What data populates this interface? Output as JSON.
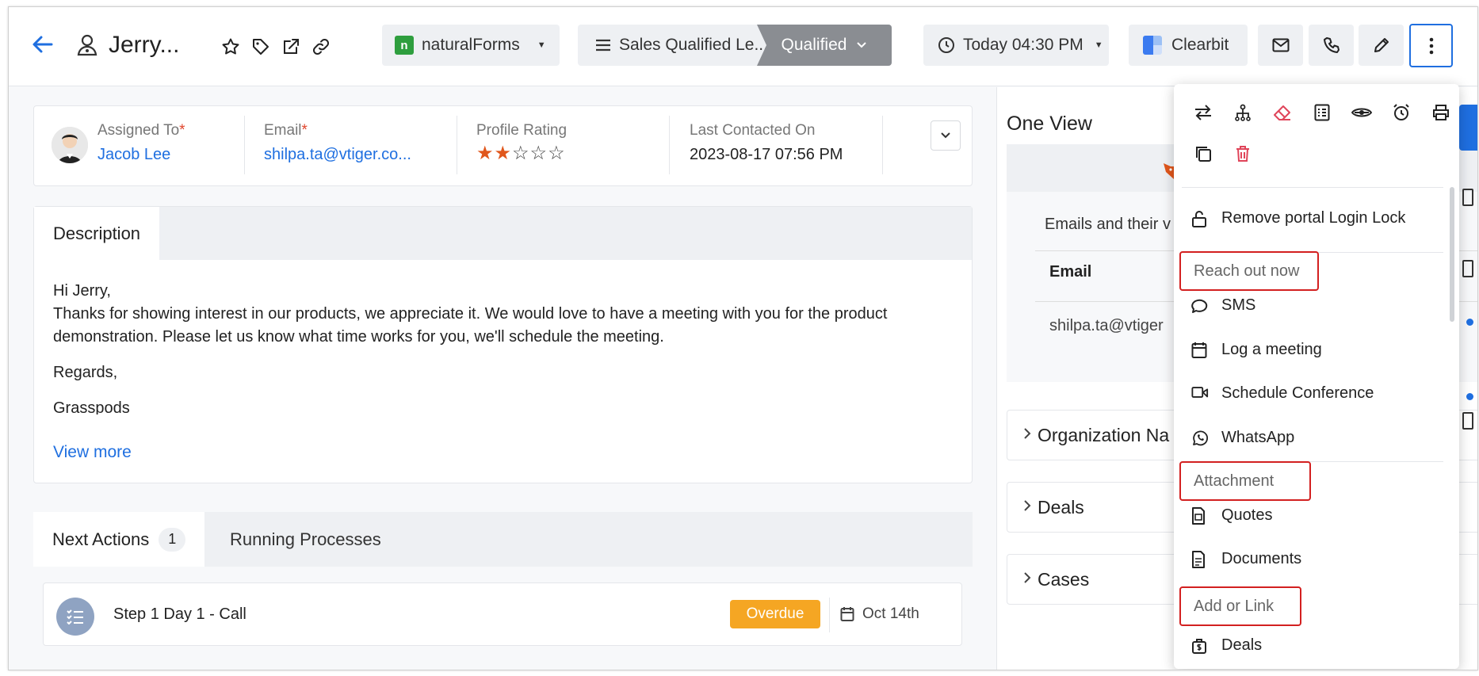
{
  "header": {
    "record_name": "Jerry...",
    "natural_forms_label": "naturalForms",
    "stage_label": "Sales Qualified Le...",
    "stage_status": "Qualified",
    "date_label": "Today 04:30 PM",
    "clearbit_label": "Clearbit"
  },
  "info": {
    "assigned_to_label": "Assigned To",
    "assigned_to_value": "Jacob Lee",
    "email_label": "Email",
    "email_value": "shilpa.ta@vtiger.co...",
    "profile_rating_label": "Profile Rating",
    "profile_rating_value": 2,
    "profile_rating_max": 5,
    "last_contacted_label": "Last Contacted On",
    "last_contacted_value": "2023-08-17 07:56 PM",
    "required_mark": "*"
  },
  "description": {
    "tab_label": "Description",
    "lines": [
      "Hi Jerry,",
      "Thanks for showing interest in our products, we appreciate it. We would love to have a meeting with you for the product demonstration. Please let us know what time works for you, we'll schedule the meeting.",
      "Regards,",
      "Grasspods"
    ],
    "view_more": "View more"
  },
  "next_actions": {
    "tab_label": "Next Actions",
    "count": "1",
    "running_tab": "Running Processes",
    "step_name": "Step 1 Day 1 - Call",
    "status": "Overdue",
    "due_date": "Oct 14th"
  },
  "one_view": {
    "title": "One View",
    "emails_text": "Emails and their v",
    "email_header": "Email",
    "email_value": "shilpa.ta@vtiger",
    "sections": [
      "Organization Na",
      "Deals",
      "Cases"
    ]
  },
  "dropdown": {
    "quick_actions": [
      "transfer-icon",
      "hierarchy-icon",
      "eraser-icon",
      "checklist-icon",
      "eye-slash-icon",
      "alarm-icon",
      "print-icon",
      "duplicate-icon",
      "delete-icon"
    ],
    "remove_lock": "Remove portal Login Lock",
    "reach_out_header": "Reach out now",
    "sms": "SMS",
    "log_meeting": "Log a meeting",
    "schedule_conference": "Schedule Conference",
    "whatsapp": "WhatsApp",
    "attachment_header": "Attachment",
    "quotes": "Quotes",
    "documents": "Documents",
    "add_link_header": "Add or Link",
    "deals": "Deals"
  },
  "colors": {
    "accent": "#1f6fe0",
    "highlight_border": "#d32020",
    "overdue": "#f5a623",
    "star": "#e0561b"
  }
}
